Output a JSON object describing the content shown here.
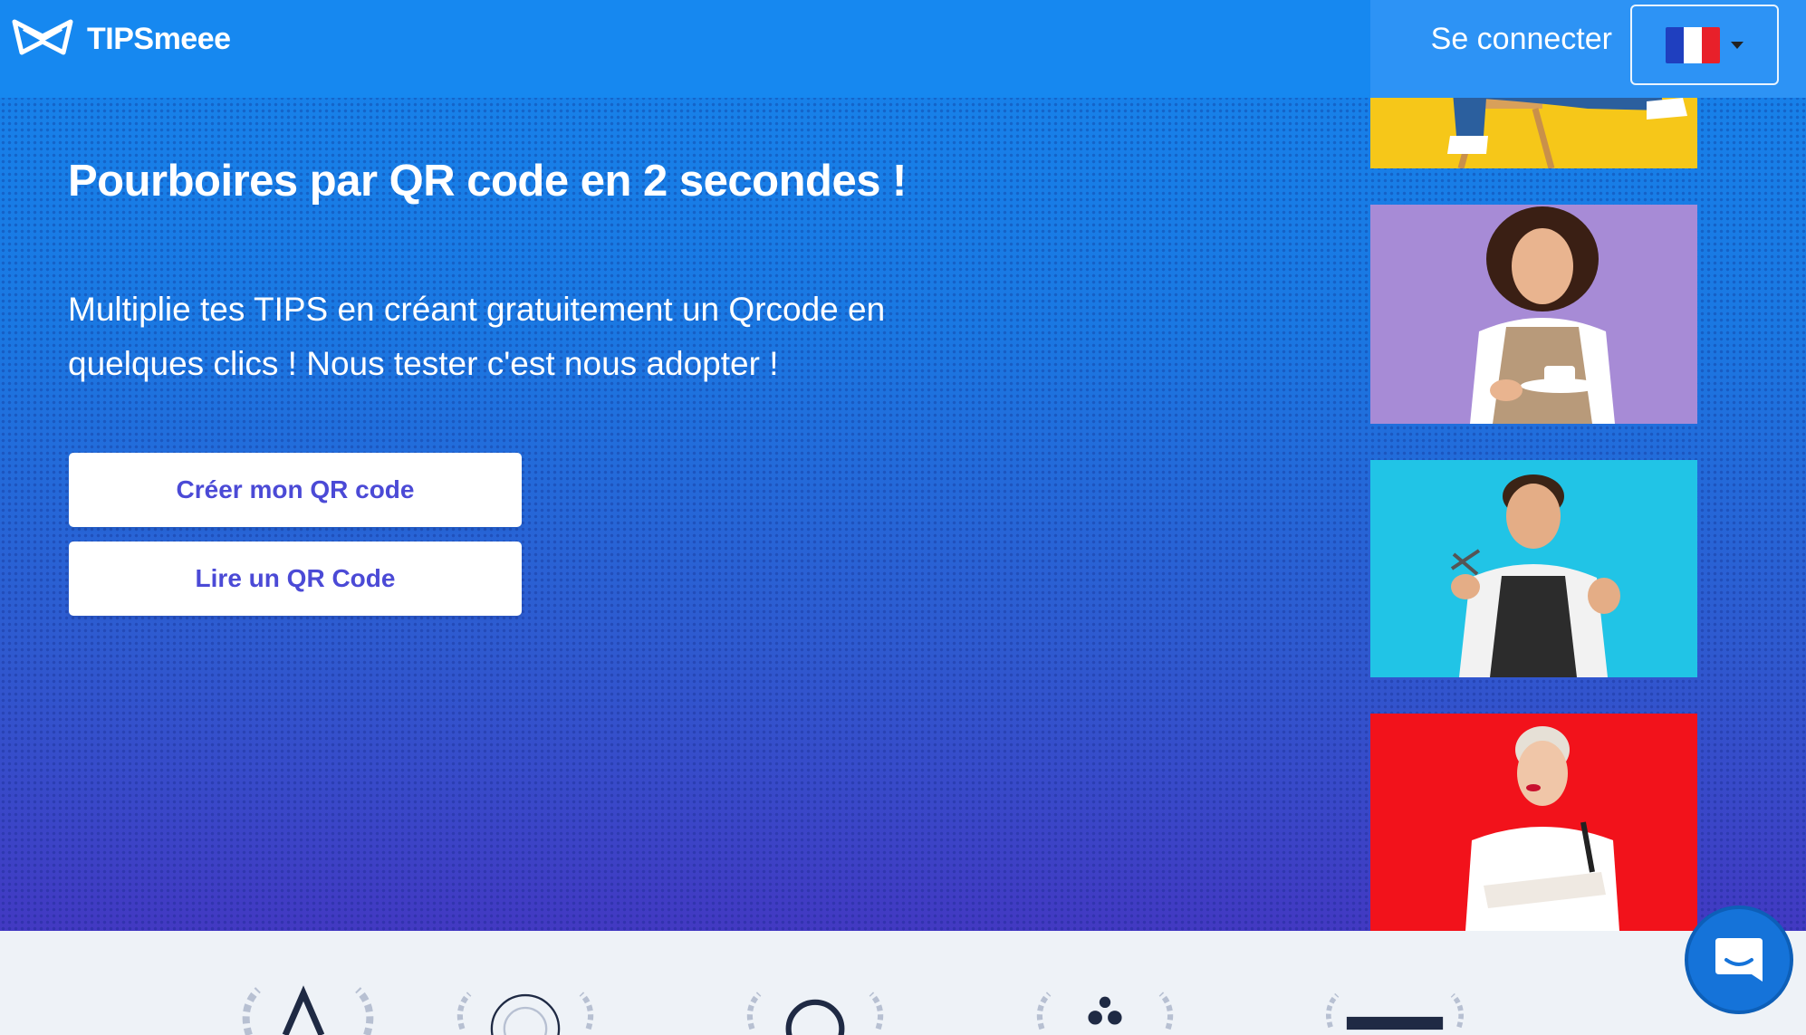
{
  "brand": {
    "name": "TIPSmeee",
    "logo_icon": "bowtie-logo-icon"
  },
  "nav": {
    "login_label": "Se connecter",
    "language": {
      "selected": "fr",
      "flag_icon": "france-flag-icon",
      "flag_colors": [
        "#1f3fbf",
        "#ffffff",
        "#e8202a"
      ]
    }
  },
  "hero": {
    "title": "Pourboires par QR code en 2 secondes !",
    "subtitle": "Multiplie tes TIPS en créant gratuitement un Qrcode en quelques clics ! Nous tester c'est nous adopter !",
    "primary_cta": "Créer mon QR code",
    "secondary_cta": "Lire un QR Code"
  },
  "photos": [
    {
      "name": "person-on-chair-photo",
      "background": "#f6c719"
    },
    {
      "name": "waitress-with-coffee-photo",
      "background": "#a78bd6"
    },
    {
      "name": "barber-with-scissors-photo",
      "background": "#21c4e6"
    },
    {
      "name": "makeup-artist-photo",
      "background": "#f2121b"
    }
  ],
  "partners": [
    "award-logo-1",
    "award-logo-2",
    "award-logo-3",
    "award-logo-4",
    "award-logo-5"
  ],
  "chat": {
    "icon": "chat-bubble-icon"
  },
  "colors": {
    "nav": "#1688f0",
    "accent": "#4b4ad6",
    "chat": "#1573d9"
  }
}
